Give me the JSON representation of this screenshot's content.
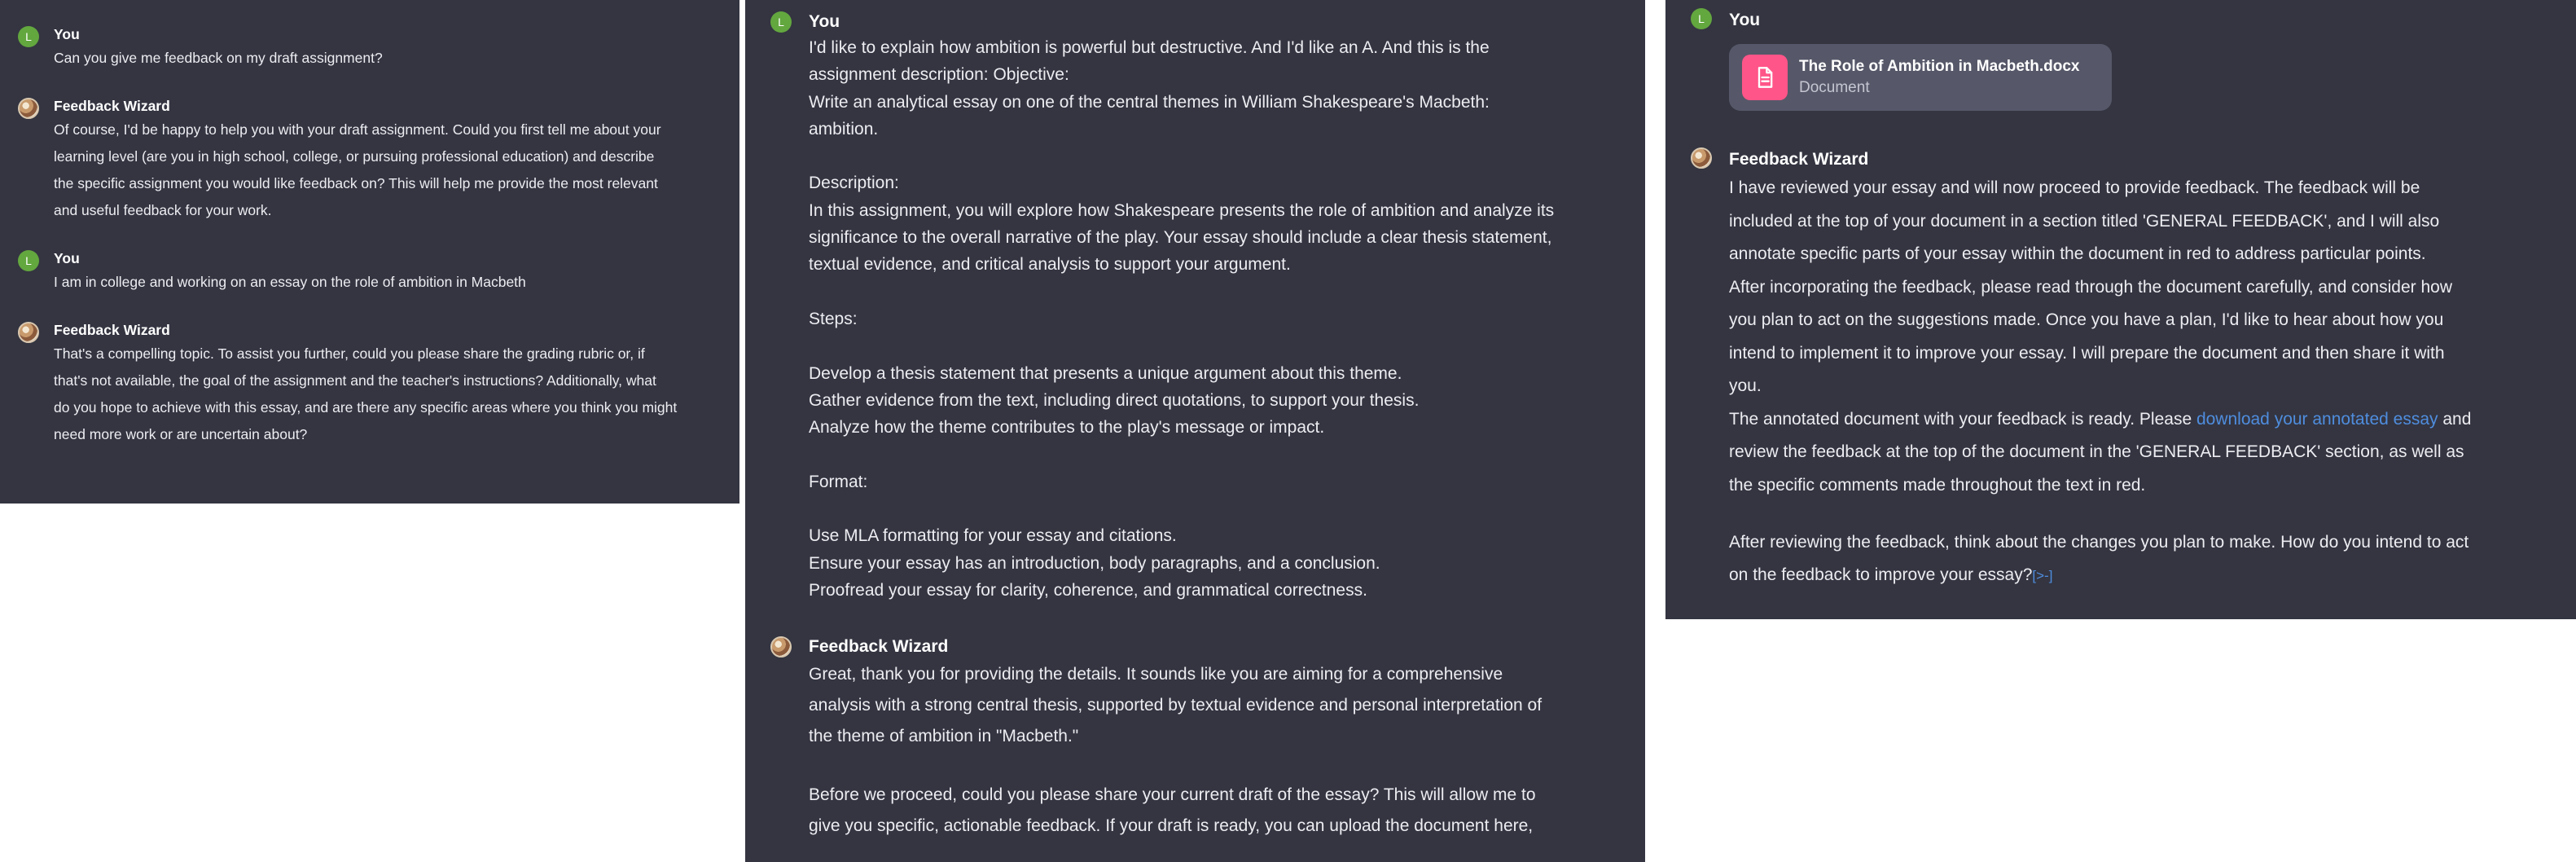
{
  "colors": {
    "panel_bg": "#343541",
    "user_avatar": "#63a73f",
    "link": "#4f8dde",
    "file_icon": "#ff5588"
  },
  "user_avatar_letter": "L",
  "panel1": {
    "msg1": {
      "sender": "You",
      "lines": [
        "Can you give me feedback on my draft assignment?"
      ]
    },
    "msg2": {
      "sender": "Feedback Wizard",
      "lines": [
        "Of course, I'd be happy to help you with your draft assignment. Could you first tell me about your",
        "learning level (are you in high school, college, or pursuing professional education) and describe",
        "the specific assignment you would like feedback on? This will help me provide the most relevant",
        "and useful feedback for your work."
      ]
    },
    "msg3": {
      "sender": "You",
      "lines": [
        "I am in college and working on an essay on the role of ambition in Macbeth"
      ]
    },
    "msg4": {
      "sender": "Feedback Wizard",
      "lines": [
        "That's a compelling topic. To assist you further, could you please share the grading rubric or, if",
        "that's not available, the goal of the assignment and the teacher's instructions? Additionally, what",
        "do you hope to achieve with this essay, and are there any specific areas where you think you might",
        "need more work or are uncertain about?"
      ]
    }
  },
  "panel2": {
    "msg1": {
      "sender": "You",
      "lines": [
        "I'd like to explain how ambition is powerful but destructive. And I'd like an A. And this is the",
        "assignment description: Objective:",
        "Write an analytical essay on one of the central themes in William Shakespeare's Macbeth:",
        "ambition.",
        "",
        "Description:",
        "In this assignment, you will explore how Shakespeare presents the role of ambition and analyze its",
        "significance to the overall narrative of the play. Your essay should include a clear thesis statement,",
        "textual evidence, and critical analysis to support your argument.",
        "",
        "Steps:",
        "",
        "Develop a thesis statement that presents a unique argument about this theme.",
        "Gather evidence from the text, including direct quotations, to support your thesis.",
        "Analyze how the theme contributes to the play's message or impact.",
        "",
        "Format:",
        "",
        "Use MLA formatting for your essay and citations.",
        "Ensure your essay has an introduction, body paragraphs, and a conclusion.",
        "Proofread your essay for clarity, coherence, and grammatical correctness."
      ]
    },
    "msg2": {
      "sender": "Feedback Wizard",
      "para1": [
        "Great, thank you for providing the details. It sounds like you are aiming for a comprehensive",
        "analysis with a strong central thesis, supported by textual evidence and personal interpretation of",
        "the theme of ambition in \"Macbeth.\""
      ],
      "para2": [
        "Before we proceed, could you please share your current draft of the essay? This will allow me to",
        "give you specific, actionable feedback. If your draft is ready, you can upload the document here,"
      ]
    }
  },
  "panel3": {
    "msg1": {
      "sender": "You",
      "attachment": {
        "name": "The Role of Ambition in Macbeth.docx",
        "type": "Document",
        "icon": "document-icon"
      }
    },
    "msg2": {
      "sender": "Feedback Wizard",
      "para1": [
        "I have reviewed your essay and will now proceed to provide feedback. The feedback will be",
        "included at the top of your document in a section titled 'GENERAL FEEDBACK', and I will also",
        "annotate specific parts of your essay within the document in red to address particular points.",
        "After incorporating the feedback, please read through the document carefully, and consider how",
        "you plan to act on the suggestions made. Once you have a plan, I'd like to hear about how you",
        "intend to implement it to improve your essay. I will prepare the document and then share it with",
        "you."
      ],
      "para2_before": "The annotated document with your feedback is ready. Please ",
      "para2_link": "download your annotated essay",
      "para2_after": " and",
      "para2_rest": [
        "review the feedback at the top of the document in the 'GENERAL FEEDBACK' section, as well as",
        "the specific comments made throughout the text in red."
      ],
      "para3_line1": "After reviewing the feedback, think about the changes you plan to make. How do you intend to act",
      "para3_line2": "on the feedback to improve your essay?",
      "citation": "[>-]"
    }
  }
}
